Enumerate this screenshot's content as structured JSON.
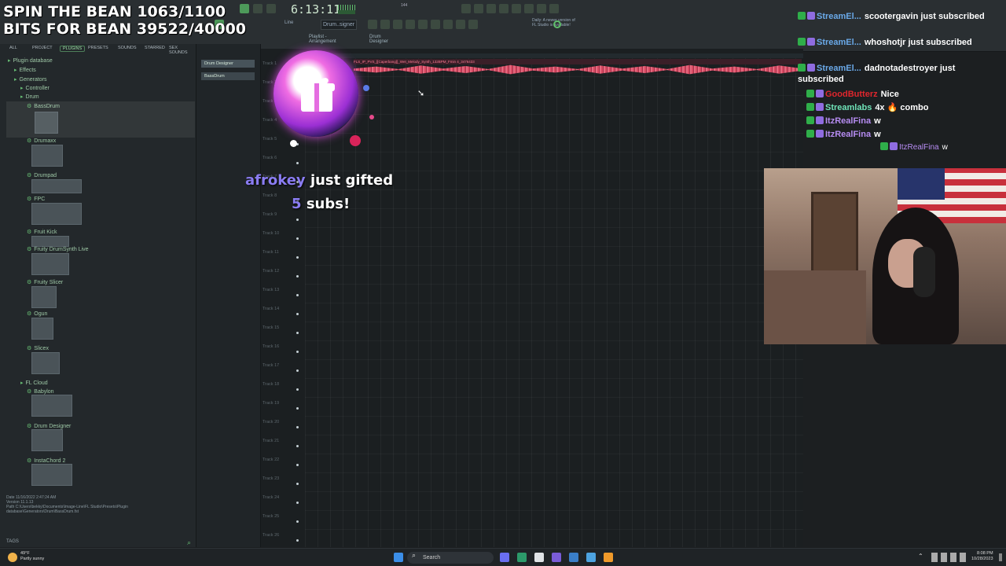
{
  "overlay": {
    "title_line1": "SPIN THE BEAN 1063/1100",
    "title_line2": "BITS FOR BEAN 39522/40000"
  },
  "toolbar": {
    "clock": "6:13:11",
    "tempo": "144",
    "pattern": "Drum..signer",
    "new_version": "Daily: A newer version of FL Studio is available!",
    "playlist_title": "Playlist - Arrangement",
    "playlist_channel": "Drum Designer",
    "mode": "Line"
  },
  "browser": {
    "tabs": [
      "ALL",
      "PROJECT",
      "PLUGINS",
      "PRESETS",
      "SOUNDS",
      "STARRED",
      "SEX SOUNDS"
    ],
    "selected_tab": "PLUGINS",
    "tree": [
      {
        "label": "Plugin database",
        "indent": 0
      },
      {
        "label": "Effects",
        "indent": 1
      },
      {
        "label": "Generators",
        "indent": 1
      },
      {
        "label": "Controller",
        "indent": 2
      },
      {
        "label": "Drum",
        "indent": 2
      },
      {
        "label": "BassDrum",
        "indent": 3
      },
      {
        "label": "Drumaxx",
        "indent": 3
      },
      {
        "label": "Drumpad",
        "indent": 3
      },
      {
        "label": "FPC",
        "indent": 3
      },
      {
        "label": "Fruit Kick",
        "indent": 3
      },
      {
        "label": "Fruity DrumSynth Live",
        "indent": 3
      },
      {
        "label": "Fruity Slicer",
        "indent": 3
      },
      {
        "label": "Ogun",
        "indent": 3
      },
      {
        "label": "Slicex",
        "indent": 3
      },
      {
        "label": "FL Cloud",
        "indent": 2
      },
      {
        "label": "Babylon",
        "indent": 3
      },
      {
        "label": "Drum Designer",
        "indent": 3
      },
      {
        "label": "InstaChord 2",
        "indent": 3
      }
    ],
    "info_date": "Date   11/16/2022 2:47:24 AM",
    "info_version": "Version 11.1.13",
    "info_path": "Path   C:\\Users\\bekky\\Documents\\Image-Line\\FL Studio\\Presets\\Plugin database\\Generators\\Drum\\BassDrum.fst",
    "tags_label": "TAGS"
  },
  "channels": [
    "Drum Designer",
    "BassDrum"
  ],
  "playlist": {
    "clip_label": "FLS_IP_PVS_[[Caperbang]]_Wet_Melody_Synth_132BPM_Fmin 4_3476433",
    "tracks": [
      "Track 1",
      "Track 2",
      "Track 3",
      "Track 4",
      "Track 5",
      "Track 6",
      "Track 7",
      "Track 8",
      "Track 9",
      "Track 10",
      "Track 11",
      "Track 12",
      "Track 13",
      "Track 14",
      "Track 15",
      "Track 16",
      "Track 17",
      "Track 18",
      "Track 19",
      "Track 20",
      "Track 21",
      "Track 22",
      "Track 23",
      "Track 24",
      "Track 25",
      "Track 26"
    ]
  },
  "chat": [
    {
      "user": "StreamEl...",
      "text": "scootergavin just subscribed",
      "color": "#6aa9e8"
    },
    {
      "user": "StreamEl...",
      "text": "whoshotjr just subscribed",
      "color": "#6aa9e8"
    },
    {
      "user": "StreamEl...",
      "text": "dadnotadestroyer just subscribed",
      "color": "#6aa9e8"
    },
    {
      "user": "GoodButterz",
      "text": "Nice",
      "color": "#e0262d"
    },
    {
      "user": "Streamlabs",
      "text": "4x 🔥 combo",
      "color": "#6fe3b8"
    },
    {
      "user": "ItzRealFina",
      "text": "w",
      "color": "#b68cf2"
    },
    {
      "user": "ItzRealFina",
      "text": "w",
      "color": "#b68cf2"
    },
    {
      "user": "ItzRealFina",
      "text": "w",
      "color": "#b68cf2"
    }
  ],
  "alert": {
    "name": "afrokey",
    "line1_rest": "just gifted",
    "count": "5",
    "line2_rest": "subs!"
  },
  "taskbar": {
    "weather_temp": "49°F",
    "weather_desc": "Partly sunny",
    "search_placeholder": "Search",
    "time": "8:08 PM",
    "date": "10/28/2023"
  },
  "colors": {
    "accent": "#67bd73",
    "alert_name": "#8a7cf2",
    "waveform": "#d84a63"
  }
}
